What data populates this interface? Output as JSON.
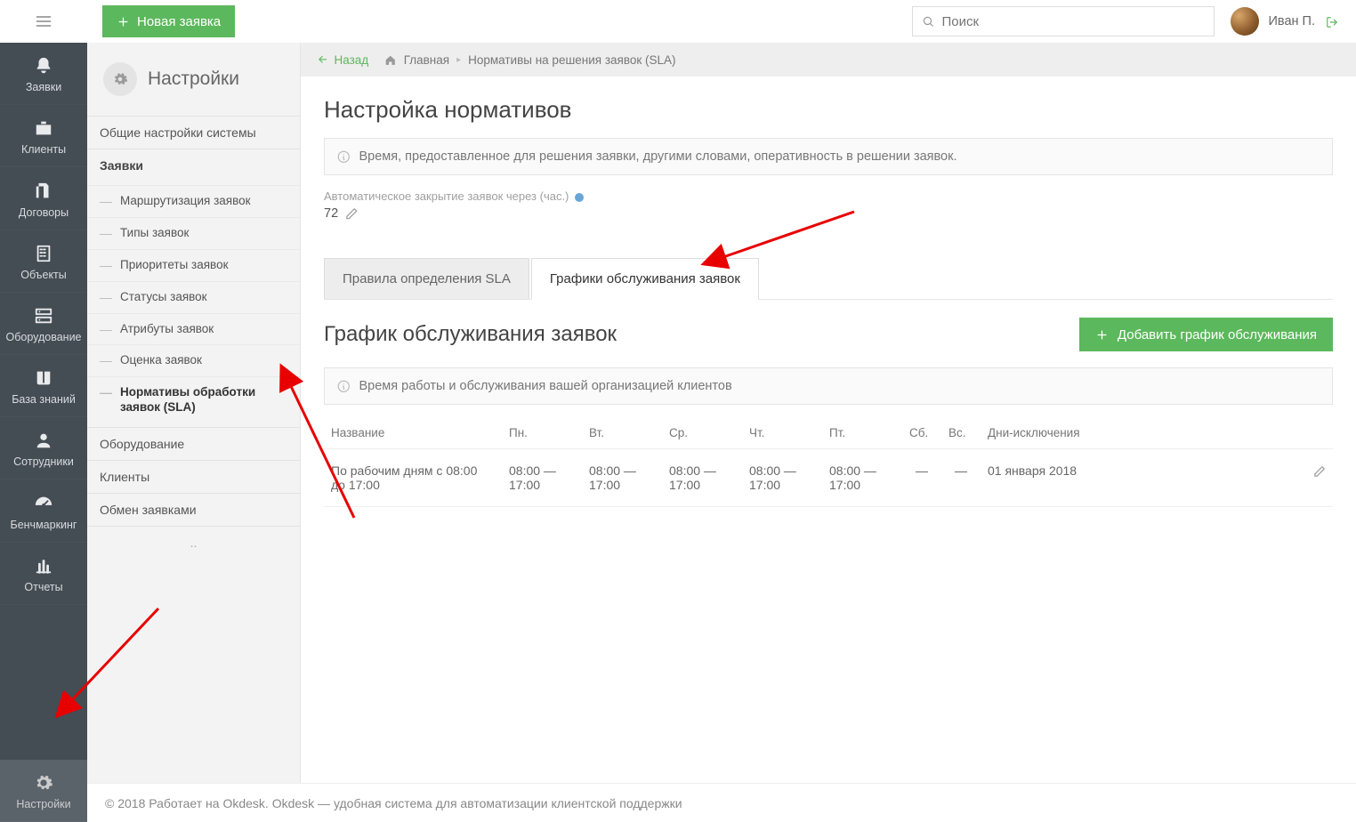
{
  "topbar": {
    "new_ticket": "Новая заявка",
    "search_placeholder": "Поиск",
    "user_name": "Иван П."
  },
  "rail": {
    "items": [
      {
        "label": "Заявки",
        "icon": "bell"
      },
      {
        "label": "Клиенты",
        "icon": "briefcase"
      },
      {
        "label": "Договоры",
        "icon": "files"
      },
      {
        "label": "Объекты",
        "icon": "building"
      },
      {
        "label": "Оборудование",
        "icon": "server"
      },
      {
        "label": "База знаний",
        "icon": "book"
      },
      {
        "label": "Сотрудники",
        "icon": "user"
      },
      {
        "label": "Бенчмаркинг",
        "icon": "gauge"
      },
      {
        "label": "Отчеты",
        "icon": "chart"
      }
    ],
    "settings_label": "Настройки"
  },
  "settings_nav": {
    "title": "Настройки",
    "groups": [
      {
        "title": "Общие настройки системы",
        "light": true
      },
      {
        "title": "Заявки",
        "subs": [
          "Маршрутизация заявок",
          "Типы заявок",
          "Приоритеты заявок",
          "Статусы заявок",
          "Атрибуты заявок",
          "Оценка заявок",
          "Нормативы обработки заявок (SLA)"
        ]
      },
      {
        "title": "Оборудование",
        "light": true
      },
      {
        "title": "Клиенты",
        "light": true
      },
      {
        "title": "Обмен заявками",
        "light": true
      },
      {
        "title": "..",
        "light": true
      }
    ]
  },
  "crumbs": {
    "back": "Назад",
    "home": "Главная",
    "current": "Нормативы на решения заявок (SLA)"
  },
  "page": {
    "title": "Настройка нормативов",
    "info": "Время, предоставленное для решения заявки, другими словами, оперативность в решении заявок.",
    "autoclose_label": "Автоматическое закрытие заявок через (час.)",
    "autoclose_value": "72",
    "tabs": {
      "rules": "Правила определения SLA",
      "schedules": "Графики обслуживания заявок"
    },
    "subhead": "График обслуживания заявок",
    "add_button": "Добавить график обслуживания",
    "sub_info": "Время работы и обслуживания вашей организацией клиентов",
    "table": {
      "headers": {
        "name": "Название",
        "mon": "Пн.",
        "tue": "Вт.",
        "wed": "Ср.",
        "thu": "Чт.",
        "fri": "Пт.",
        "sat": "Сб.",
        "sun": "Вс.",
        "exc": "Дни-исключения"
      },
      "rows": [
        {
          "name": "По рабочим дням с 08:00 до 17:00",
          "mon": "08:00 — 17:00",
          "tue": "08:00 — 17:00",
          "wed": "08:00 — 17:00",
          "thu": "08:00 — 17:00",
          "fri": "08:00 — 17:00",
          "sat": "—",
          "sun": "—",
          "exc": "01 января 2018"
        }
      ]
    }
  },
  "footer": {
    "text": "© 2018 Работает на Okdesk. Okdesk — удобная система для автоматизации клиентской поддержки"
  }
}
